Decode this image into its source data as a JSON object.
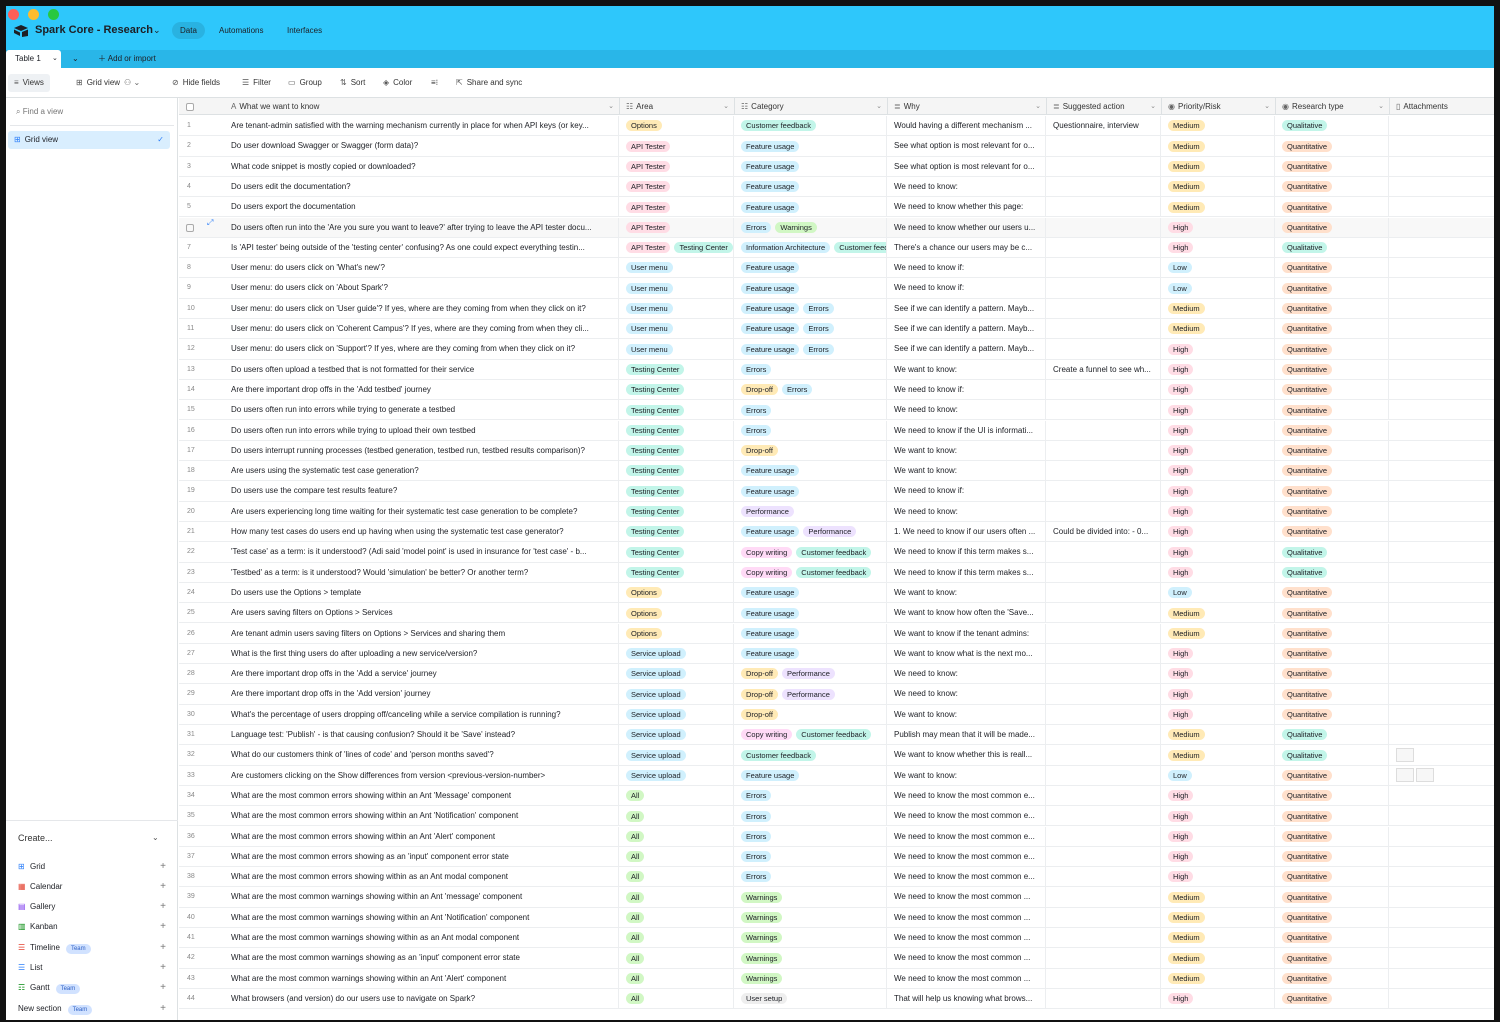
{
  "app": {
    "base_name": "Spark Core - Research",
    "tabs": [
      "Data",
      "Automations",
      "Interfaces"
    ],
    "table_tab": "Table 1",
    "add_import": "Add or import"
  },
  "toolbar": {
    "views": "Views",
    "grid_view": "Grid view",
    "hide_fields": "Hide fields",
    "filter": "Filter",
    "group": "Group",
    "sort": "Sort",
    "color": "Color",
    "share": "Share and sync"
  },
  "sidebar": {
    "find_placeholder": "Find a view",
    "grid_view_item": "Grid view",
    "create_label": "Create...",
    "create_items": [
      {
        "label": "Grid",
        "icon": "grid-icon",
        "badge": ""
      },
      {
        "label": "Calendar",
        "icon": "calendar-icon",
        "badge": ""
      },
      {
        "label": "Gallery",
        "icon": "gallery-icon",
        "badge": ""
      },
      {
        "label": "Kanban",
        "icon": "kanban-icon",
        "badge": ""
      },
      {
        "label": "Timeline",
        "icon": "timeline-icon",
        "badge": "Team"
      },
      {
        "label": "List",
        "icon": "list-icon",
        "badge": ""
      },
      {
        "label": "Gantt",
        "icon": "gantt-icon",
        "badge": "Team"
      },
      {
        "label": "New section",
        "icon": "",
        "badge": "Team"
      }
    ]
  },
  "columns": [
    "What we want to know",
    "Area",
    "Category",
    "Why",
    "Suggested action",
    "Priority/Risk",
    "Research type",
    "Attachments"
  ],
  "colors": {
    "header_bg": "#2ec7fb",
    "Options": "#ffeab6",
    "API Tester": "#ffdce5",
    "Testing Center": "#c2f5e9",
    "User menu": "#d0f0fd",
    "Service upload": "#d0f0fd",
    "All": "#d1f7c4",
    "Customer feedback": "#c2f5e9",
    "Feature usage": "#d0f0fd",
    "Warnings": "#d1f7c4",
    "Errors": "#d0f0fd",
    "Information Architecture": "#d0f0fd",
    "Drop-off": "#ffeab6",
    "Performance": "#ede2fe",
    "Copy writing": "#ffdaf6",
    "User setup": "#eeeeee",
    "High": "#ffdce5",
    "Medium": "#ffeab6",
    "Low": "#d0f0fd",
    "Qualitative": "#c2f5e9",
    "Quantitative": "#ffe0cc"
  },
  "rows": [
    {
      "n": "1",
      "know": "Are tenant-admin satisfied with the warning mechanism currently in place for when API keys (or key...",
      "area": [
        "Options"
      ],
      "cat": [
        "Customer feedback"
      ],
      "why": "Would having a different mechanism ...",
      "sug": "Questionnaire, interview",
      "pri": "Medium",
      "res": "Qualitative",
      "att": 0
    },
    {
      "n": "2",
      "know": "Do user download Swagger or Swagger (form data)?",
      "area": [
        "API Tester"
      ],
      "cat": [
        "Feature usage"
      ],
      "why": "See what option is most relevant for o...",
      "sug": "",
      "pri": "Medium",
      "res": "Quantitative",
      "att": 0
    },
    {
      "n": "3",
      "know": "What code snippet is mostly copied or downloaded?",
      "area": [
        "API Tester"
      ],
      "cat": [
        "Feature usage"
      ],
      "why": "See what option is most relevant for o...",
      "sug": "",
      "pri": "Medium",
      "res": "Quantitative",
      "att": 0
    },
    {
      "n": "4",
      "know": "Do users edit the documentation?",
      "area": [
        "API Tester"
      ],
      "cat": [
        "Feature usage"
      ],
      "why": "We need to know:",
      "sug": "",
      "pri": "Medium",
      "res": "Quantitative",
      "att": 0
    },
    {
      "n": "5",
      "know": "Do users export the documentation",
      "area": [
        "API Tester"
      ],
      "cat": [
        "Feature usage"
      ],
      "why": "We need to know whether this page:",
      "sug": "",
      "pri": "Medium",
      "res": "Quantitative",
      "att": 0
    },
    {
      "n": "",
      "know": "Do users often run into the 'Are you sure you want to leave?' after trying to leave the API tester docu...",
      "area": [
        "API Tester"
      ],
      "cat": [
        "Errors",
        "Warnings"
      ],
      "why": "We need to know whether our users u...",
      "sug": "",
      "pri": "High",
      "res": "Quantitative",
      "att": 0
    },
    {
      "n": "7",
      "know": "Is 'API tester' being outside of the 'testing center' confusing? As one could expect everything testin...",
      "area": [
        "API Tester",
        "Testing Center"
      ],
      "cat": [
        "Information Architecture",
        "Customer feedback"
      ],
      "why": "There's a chance our users may be c...",
      "sug": "",
      "pri": "High",
      "res": "Qualitative",
      "att": 0
    },
    {
      "n": "8",
      "know": "User menu: do users click on 'What's new'?",
      "area": [
        "User menu"
      ],
      "cat": [
        "Feature usage"
      ],
      "why": "We need to know if:",
      "sug": "",
      "pri": "Low",
      "res": "Quantitative",
      "att": 0
    },
    {
      "n": "9",
      "know": "User menu: do users click on 'About Spark'?",
      "area": [
        "User menu"
      ],
      "cat": [
        "Feature usage"
      ],
      "why": "We need to know if:",
      "sug": "",
      "pri": "Low",
      "res": "Quantitative",
      "att": 0
    },
    {
      "n": "10",
      "know": "User menu: do users click on 'User guide'? If yes, where are they coming from when they click on it?",
      "area": [
        "User menu"
      ],
      "cat": [
        "Feature usage",
        "Errors"
      ],
      "why": "See if we can identify a pattern. Mayb...",
      "sug": "",
      "pri": "Medium",
      "res": "Quantitative",
      "att": 0
    },
    {
      "n": "11",
      "know": "User menu: do users click on 'Coherent Campus'? If yes, where are they coming from when they cli...",
      "area": [
        "User menu"
      ],
      "cat": [
        "Feature usage",
        "Errors"
      ],
      "why": "See if we can identify a pattern. Mayb...",
      "sug": "",
      "pri": "Medium",
      "res": "Quantitative",
      "att": 0
    },
    {
      "n": "12",
      "know": "User menu: do users click on 'Support'? If yes, where are they coming from when they click on it?",
      "area": [
        "User menu"
      ],
      "cat": [
        "Feature usage",
        "Errors"
      ],
      "why": "See if we can identify a pattern. Mayb...",
      "sug": "",
      "pri": "High",
      "res": "Quantitative",
      "att": 0
    },
    {
      "n": "13",
      "know": "Do users often upload a testbed that is not formatted for their service",
      "area": [
        "Testing Center"
      ],
      "cat": [
        "Errors"
      ],
      "why": "We want to know:",
      "sug": "Create a funnel to see wh...",
      "pri": "High",
      "res": "Quantitative",
      "att": 0
    },
    {
      "n": "14",
      "know": "Are there important drop offs in the 'Add testbed' journey",
      "area": [
        "Testing Center"
      ],
      "cat": [
        "Drop-off",
        "Errors"
      ],
      "why": "We need to know if:",
      "sug": "",
      "pri": "High",
      "res": "Quantitative",
      "att": 0
    },
    {
      "n": "15",
      "know": "Do users often run into errors while trying to generate a testbed",
      "area": [
        "Testing Center"
      ],
      "cat": [
        "Errors"
      ],
      "why": "We need to know:",
      "sug": "",
      "pri": "High",
      "res": "Quantitative",
      "att": 0
    },
    {
      "n": "16",
      "know": "Do users often run into errors while trying to upload their own testbed",
      "area": [
        "Testing Center"
      ],
      "cat": [
        "Errors"
      ],
      "why": "We need to know if the UI is informati...",
      "sug": "",
      "pri": "High",
      "res": "Quantitative",
      "att": 0
    },
    {
      "n": "17",
      "know": "Do users interrupt running processes (testbed generation, testbed run, testbed results comparison)?",
      "area": [
        "Testing Center"
      ],
      "cat": [
        "Drop-off"
      ],
      "why": "We want to know:",
      "sug": "",
      "pri": "High",
      "res": "Quantitative",
      "att": 0
    },
    {
      "n": "18",
      "know": "Are users using the systematic test case generation?",
      "area": [
        "Testing Center"
      ],
      "cat": [
        "Feature usage"
      ],
      "why": "We want to know:",
      "sug": "",
      "pri": "High",
      "res": "Quantitative",
      "att": 0
    },
    {
      "n": "19",
      "know": "Do users use the compare test results feature?",
      "area": [
        "Testing Center"
      ],
      "cat": [
        "Feature usage"
      ],
      "why": "We need to know if:",
      "sug": "",
      "pri": "High",
      "res": "Quantitative",
      "att": 0
    },
    {
      "n": "20",
      "know": "Are users experiencing long time waiting for their systematic test case generation to be complete?",
      "area": [
        "Testing Center"
      ],
      "cat": [
        "Performance"
      ],
      "why": "We need to know:",
      "sug": "",
      "pri": "High",
      "res": "Quantitative",
      "att": 0
    },
    {
      "n": "21",
      "know": "How many test cases do users end up having when using the systematic test case generator?",
      "area": [
        "Testing Center"
      ],
      "cat": [
        "Feature usage",
        "Performance"
      ],
      "why": "1. We need to know if our users often ...",
      "sug": "Could be divided into: - 0...",
      "pri": "High",
      "res": "Quantitative",
      "att": 0
    },
    {
      "n": "22",
      "know": "'Test case' as a term: is it understood? (Adi said 'model point' is used in insurance for 'test case' - b...",
      "area": [
        "Testing Center"
      ],
      "cat": [
        "Copy writing",
        "Customer feedback"
      ],
      "why": "We need to know if this term makes s...",
      "sug": "",
      "pri": "High",
      "res": "Qualitative",
      "att": 0
    },
    {
      "n": "23",
      "know": "'Testbed' as a term: is it understood? Would 'simulation' be better? Or another term?",
      "area": [
        "Testing Center"
      ],
      "cat": [
        "Copy writing",
        "Customer feedback"
      ],
      "why": "We need to know if this term makes s...",
      "sug": "",
      "pri": "High",
      "res": "Qualitative",
      "att": 0
    },
    {
      "n": "24",
      "know": "Do users use the Options > template",
      "area": [
        "Options"
      ],
      "cat": [
        "Feature usage"
      ],
      "why": "We want to know:",
      "sug": "",
      "pri": "Low",
      "res": "Quantitative",
      "att": 0
    },
    {
      "n": "25",
      "know": "Are users saving filters on Options > Services",
      "area": [
        "Options"
      ],
      "cat": [
        "Feature usage"
      ],
      "why": "We want to know how often the 'Save...",
      "sug": "",
      "pri": "Medium",
      "res": "Quantitative",
      "att": 0
    },
    {
      "n": "26",
      "know": "Are tenant admin users saving filters on Options > Services and sharing them",
      "area": [
        "Options"
      ],
      "cat": [
        "Feature usage"
      ],
      "why": "We want to know if the tenant admins:",
      "sug": "",
      "pri": "Medium",
      "res": "Quantitative",
      "att": 0
    },
    {
      "n": "27",
      "know": "What is the first thing users do after uploading a new service/version?",
      "area": [
        "Service upload"
      ],
      "cat": [
        "Feature usage"
      ],
      "why": "We want to know what is the next mo...",
      "sug": "",
      "pri": "High",
      "res": "Quantitative",
      "att": 0
    },
    {
      "n": "28",
      "know": "Are there important drop offs in the 'Add a service' journey",
      "area": [
        "Service upload"
      ],
      "cat": [
        "Drop-off",
        "Performance"
      ],
      "why": "We need to know:",
      "sug": "",
      "pri": "High",
      "res": "Quantitative",
      "att": 0
    },
    {
      "n": "29",
      "know": "Are there important drop offs in the 'Add version' journey",
      "area": [
        "Service upload"
      ],
      "cat": [
        "Drop-off",
        "Performance"
      ],
      "why": "We need to know:",
      "sug": "",
      "pri": "High",
      "res": "Quantitative",
      "att": 0
    },
    {
      "n": "30",
      "know": "What's the percentage of users dropping off/canceling while a service compilation is running?",
      "area": [
        "Service upload"
      ],
      "cat": [
        "Drop-off"
      ],
      "why": "We want to know:",
      "sug": "",
      "pri": "High",
      "res": "Quantitative",
      "att": 0
    },
    {
      "n": "31",
      "know": "Language test: 'Publish' - is that causing confusion? Should it be 'Save' instead?",
      "area": [
        "Service upload"
      ],
      "cat": [
        "Copy writing",
        "Customer feedback"
      ],
      "why": "Publish may mean that it will be made...",
      "sug": "",
      "pri": "Medium",
      "res": "Qualitative",
      "att": 0
    },
    {
      "n": "32",
      "know": "What do our customers think of 'lines of code' and 'person months saved'?",
      "area": [
        "Service upload"
      ],
      "cat": [
        "Customer feedback"
      ],
      "why": "We want to know whether this is reall...",
      "sug": "",
      "pri": "Medium",
      "res": "Qualitative",
      "att": 1
    },
    {
      "n": "33",
      "know": "Are customers clicking on the Show differences from version <previous-version-number>",
      "area": [
        "Service upload"
      ],
      "cat": [
        "Feature usage"
      ],
      "why": "We want to know:",
      "sug": "",
      "pri": "Low",
      "res": "Quantitative",
      "att": 2
    },
    {
      "n": "34",
      "know": "What are the most common errors showing within an Ant 'Message' component",
      "area": [
        "All"
      ],
      "cat": [
        "Errors"
      ],
      "why": "We need to know the most common e...",
      "sug": "",
      "pri": "High",
      "res": "Quantitative",
      "att": 0
    },
    {
      "n": "35",
      "know": "What are the most common errors showing within an Ant 'Notification' component",
      "area": [
        "All"
      ],
      "cat": [
        "Errors"
      ],
      "why": "We need to know the most common e...",
      "sug": "",
      "pri": "High",
      "res": "Quantitative",
      "att": 0
    },
    {
      "n": "36",
      "know": "What are the most common errors showing within an Ant 'Alert' component",
      "area": [
        "All"
      ],
      "cat": [
        "Errors"
      ],
      "why": "We need to know the most common e...",
      "sug": "",
      "pri": "High",
      "res": "Quantitative",
      "att": 0
    },
    {
      "n": "37",
      "know": "What are the most common errors showing as an 'input' component error state",
      "area": [
        "All"
      ],
      "cat": [
        "Errors"
      ],
      "why": "We need to know the most common e...",
      "sug": "",
      "pri": "High",
      "res": "Quantitative",
      "att": 0
    },
    {
      "n": "38",
      "know": "What are the most common errors showing within as an Ant modal component",
      "area": [
        "All"
      ],
      "cat": [
        "Errors"
      ],
      "why": "We need to know the most common e...",
      "sug": "",
      "pri": "High",
      "res": "Quantitative",
      "att": 0
    },
    {
      "n": "39",
      "know": "What are the most common warnings showing within an Ant 'message' component",
      "area": [
        "All"
      ],
      "cat": [
        "Warnings"
      ],
      "why": "We need to know the most common ...",
      "sug": "",
      "pri": "Medium",
      "res": "Quantitative",
      "att": 0
    },
    {
      "n": "40",
      "know": "What are the most common warnings showing within an Ant 'Notification' component",
      "area": [
        "All"
      ],
      "cat": [
        "Warnings"
      ],
      "why": "We need to know the most common ...",
      "sug": "",
      "pri": "Medium",
      "res": "Quantitative",
      "att": 0
    },
    {
      "n": "41",
      "know": "What are the most common warnings showing within as an Ant modal component",
      "area": [
        "All"
      ],
      "cat": [
        "Warnings"
      ],
      "why": "We need to know the most common ...",
      "sug": "",
      "pri": "Medium",
      "res": "Quantitative",
      "att": 0
    },
    {
      "n": "42",
      "know": "What are the most common warnings showing as an 'input' component error state",
      "area": [
        "All"
      ],
      "cat": [
        "Warnings"
      ],
      "why": "We need to know the most common ...",
      "sug": "",
      "pri": "Medium",
      "res": "Quantitative",
      "att": 0
    },
    {
      "n": "43",
      "know": "What are the most common warnings showing within an Ant 'Alert' component",
      "area": [
        "All"
      ],
      "cat": [
        "Warnings"
      ],
      "why": "We need to know the most common ...",
      "sug": "",
      "pri": "Medium",
      "res": "Quantitative",
      "att": 0
    },
    {
      "n": "44",
      "know": "What browsers (and version) do our users use to navigate on Spark?",
      "area": [
        "All"
      ],
      "cat": [
        "User setup"
      ],
      "why": "That will help us knowing what brows...",
      "sug": "",
      "pri": "High",
      "res": "Quantitative",
      "att": 0
    }
  ]
}
